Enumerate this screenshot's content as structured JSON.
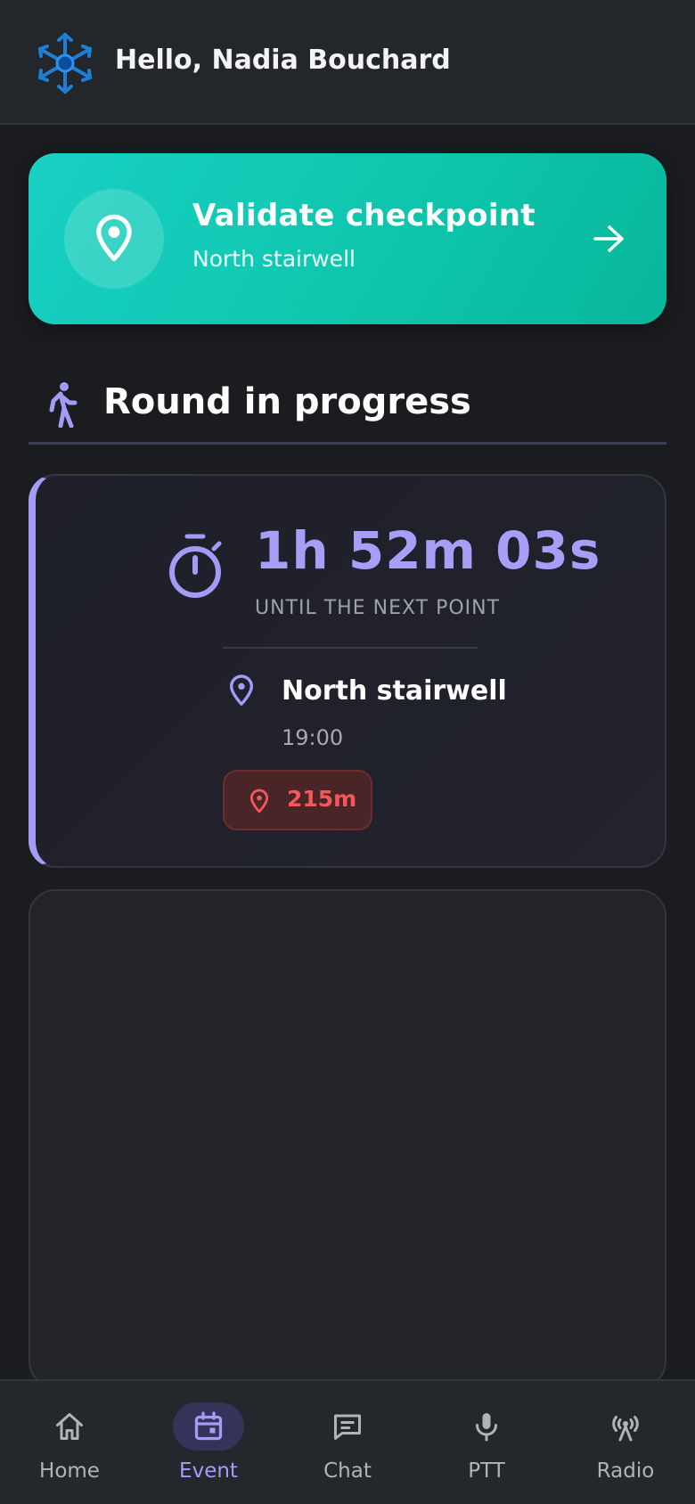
{
  "header": {
    "greeting": "Hello, Nadia Bouchard",
    "logo_icon": "snowflake-logo-icon"
  },
  "validate": {
    "title": "Validate checkpoint",
    "subtitle": "North stairwell",
    "icon": "map-pin-icon",
    "action_icon": "arrow-right-icon"
  },
  "section": {
    "title": "Round in progress",
    "icon": "walking-person-icon"
  },
  "round": {
    "countdown": "1h 52m 03s",
    "caption": "UNTIL THE NEXT POINT",
    "point_name": "North stairwell",
    "point_time": "19:00",
    "distance": "215m",
    "accent_color": "#a39bf5",
    "distance_color": "#f2585a"
  },
  "nav": {
    "items": [
      {
        "label": "Home",
        "icon": "home-icon",
        "active": false
      },
      {
        "label": "Event",
        "icon": "calendar-icon",
        "active": true
      },
      {
        "label": "Chat",
        "icon": "chat-icon",
        "active": false
      },
      {
        "label": "PTT",
        "icon": "microphone-icon",
        "active": false
      },
      {
        "label": "Radio",
        "icon": "radio-tower-icon",
        "active": false
      }
    ]
  },
  "colors": {
    "background": "#1a1c1f",
    "validate_gradient_start": "#19d0c4",
    "validate_gradient_end": "#08b79a",
    "active_nav": "#a49cf6"
  }
}
